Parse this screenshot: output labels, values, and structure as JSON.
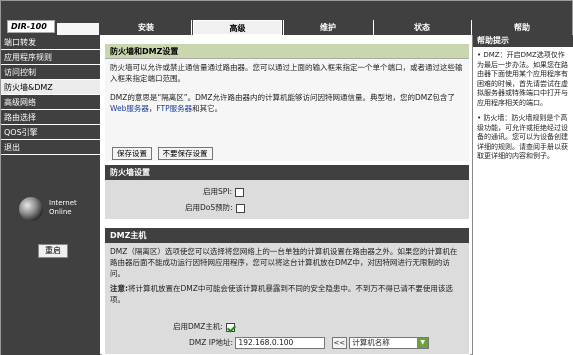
{
  "logo": "DIR-100",
  "tabs": [
    "安装",
    "高级",
    "维护",
    "状态",
    "帮助"
  ],
  "sidebar": {
    "items": [
      "端口转发",
      "应用程序规则",
      "访问控制",
      "防火墙&DMZ",
      "高级网络",
      "路由选择",
      "QOS引擎",
      "退出"
    ],
    "online_line1": "Internet",
    "online_line2": "Online",
    "reboot_label": "重启"
  },
  "intro": {
    "title": "防火墙和DMZ设置",
    "p1": "防火墙可以允许或禁止通信量通过路由器。您可以通过上面的输入框来指定一个单个端口，或者通过这些输入框来指定端口范围。",
    "p2_pre": "DMZ的意思是“隔离区”。DMZ允许路由器内的计算机能够访问因特网通信量。典型地，您的DMZ包含了",
    "p2_web": "Web服务器",
    "p2_comma": "，",
    "p2_ftp": "FTP服务器",
    "p2_post": "和其它。",
    "save_label": "保存设置",
    "nosave_label": "不要保存设置"
  },
  "firewall": {
    "title": "防火墙设置",
    "spi_label": "启用SPI:",
    "spi_checked": false,
    "dos_label": "启用DoS预防:",
    "dos_checked": false
  },
  "dmz": {
    "title": "DMZ主机",
    "desc": "DMZ（隔离区）选项使您可以选择将您网络上的一台单独的计算机设置在路由器之外。如果您的计算机在路由器后面不能成功运行因特网应用程序，您可以将这台计算机放在DMZ中，对因特网进行无限制的访问。",
    "note_label": "注意:",
    "note_text": "将计算机放置在DMZ中可能会使该计算机暴露到不同的安全隐患中。不到万不得已请不要使用该选项。",
    "enable_label": "启用DMZ主机:",
    "enable_checked": true,
    "ip_label": "DMZ IP地址:",
    "ip_value": "192.168.0.100",
    "arrow_label": "<<",
    "computer_select": "计算机名称"
  },
  "help": {
    "title": "帮助提示",
    "tip1": "• DMZ：开启DMZ选项仅作为最后一步办法。如果您在路由器下面使用某个应用程序有困难的时候，首先请尝试在虚拟服务器或特殊端口中打开与应用程序相关的端口。",
    "tip2": "• 防火墙：防火墙规则是个高级功能，可允许或拒绝经过设备的通讯。您可以为设备创建详细的规则。请查阅手册以获取更详细的内容和例子。"
  }
}
